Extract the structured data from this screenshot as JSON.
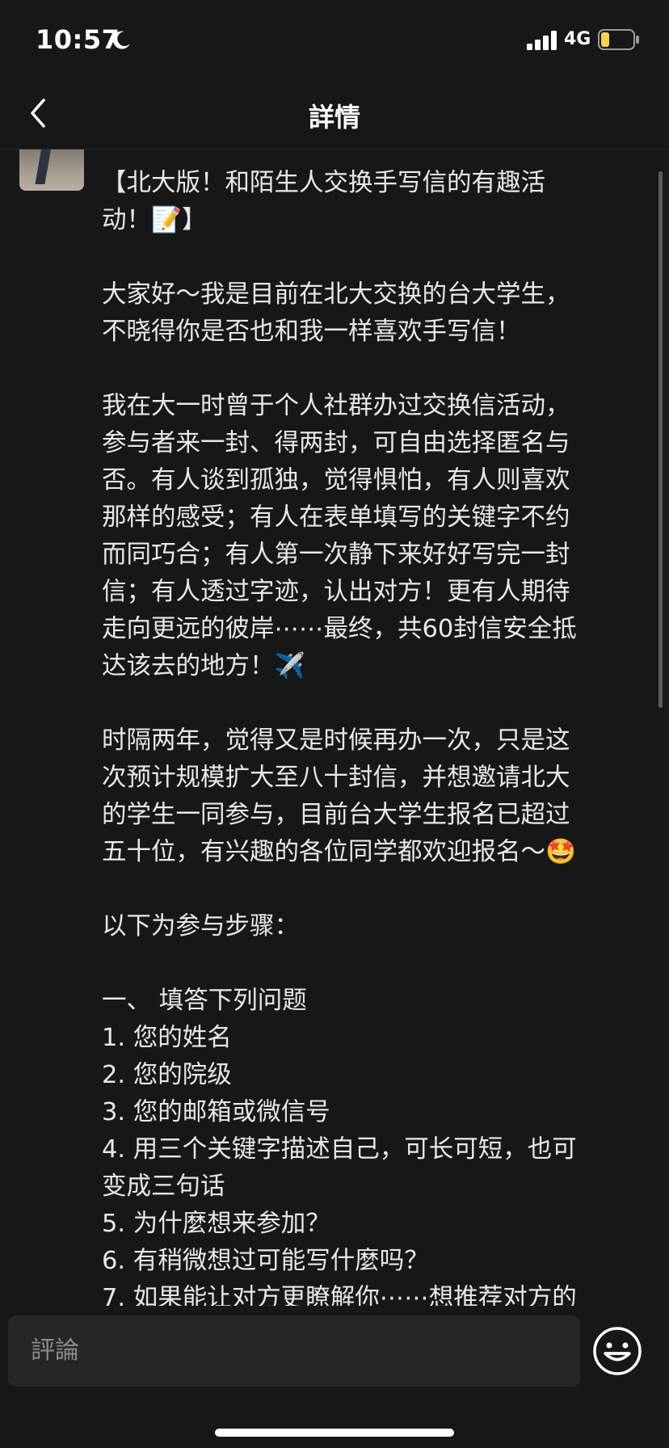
{
  "status_bar": {
    "time": "10:57",
    "network": "4G",
    "battery_level": 0.25,
    "battery_color": "#f5d547"
  },
  "nav": {
    "title": "詳情",
    "back_icon": "chevron-left-icon"
  },
  "post": {
    "lines": [
      "【北大版！和陌生人交换手写信的有趣活",
      "动！📝】",
      "",
      "大家好～我是目前在北大交换的台大学生，",
      "不晓得你是否也和我一样喜欢手写信！",
      "",
      "我在大一时曾于个人社群办过交换信活动，",
      "参与者来一封、得两封，可自由选择匿名与",
      "否。有人谈到孤独，觉得惧怕，有人则喜欢",
      "那样的感受；有人在表单填写的关键字不约",
      "而同巧合；有人第一次静下来好好写完一封",
      "信；有人透过字迹，认出对方！更有人期待",
      "走向更远的彼岸⋯⋯最终，共60封信安全抵",
      "达该去的地方！✈️",
      "",
      "时隔两年，觉得又是时候再办一次，只是这",
      "次预计规模扩大至八十封信，并想邀请北大",
      "的学生一同参与，目前台大学生报名已超过",
      "五十位，有兴趣的各位同学都欢迎报名～🤩",
      "",
      "以下为参与步骤：",
      "",
      "一、 填答下列问题",
      "1. 您的姓名",
      "2. 您的院级",
      "3. 您的邮箱或微信号",
      "4. 用三个关键字描述自己，可长可短，也可",
      "变成三句话",
      "5. 为什麼想来参加？",
      "6. 有稍微想过可能写什麼吗？",
      "7. 如果能让对方更瞭解你⋯⋯想推荐对方的"
    ]
  },
  "comment": {
    "placeholder": "評論",
    "emoji_icon": "smiley-face-icon"
  },
  "colors": {
    "background": "#171717",
    "text": "#e8e8e8",
    "input_background": "#262626"
  }
}
